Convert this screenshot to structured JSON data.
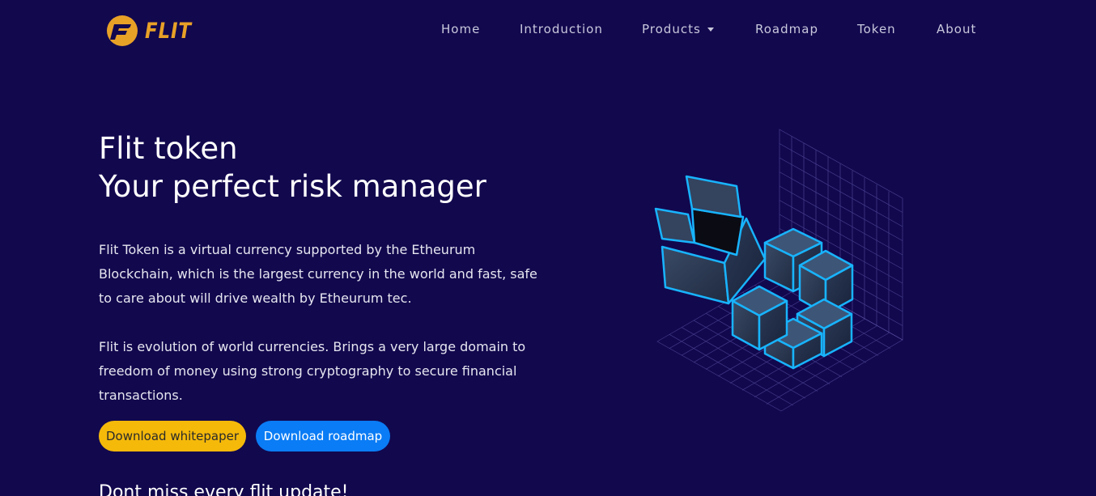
{
  "brand": {
    "name": "FLIT",
    "logo_icon": "flit-coin-icon",
    "accent": "#e8a127"
  },
  "nav": {
    "items": [
      {
        "label": "Home"
      },
      {
        "label": "Introduction"
      },
      {
        "label": "Products",
        "has_dropdown": true
      },
      {
        "label": "Roadmap"
      },
      {
        "label": "Token"
      },
      {
        "label": "About"
      }
    ]
  },
  "hero": {
    "title_line1": "Flit token",
    "title_line2": "Your perfect risk manager",
    "paragraph1": "Flit Token is a virtual currency supported by the Etheurum Blockchain, which is the largest currency in the world and fast, safe to care about will drive wealth by Etheurum tec.",
    "paragraph2": "Flit is evolution of world currencies. Brings a very large domain to freedom of money using strong cryptography to secure financial transactions.",
    "btn_whitepaper": "Download whitepaper",
    "btn_roadmap": "Download roadmap",
    "teaser": "Dont miss every flit update!"
  },
  "colors": {
    "background": "#12084e",
    "button_yellow": "#f5b90a",
    "button_blue": "#0a7cf5",
    "cube_glow": "#18b4ff"
  }
}
